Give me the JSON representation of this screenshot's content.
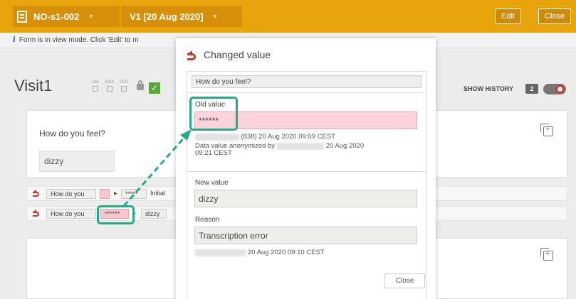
{
  "topbar": {
    "subject": "NO-s1-002",
    "visit": "V1 [20 Aug 2020]",
    "edit_label": "Edit",
    "close_label": "Close"
  },
  "info": {
    "text": "Form is in view mode. Click 'Edit' to m"
  },
  "visit": {
    "title": "Visit1",
    "flags": [
      "DM",
      "CRA",
      "SDV"
    ],
    "show_history_label": "SHOW HISTORY",
    "history_count": "2"
  },
  "form": {
    "question": "How do you feel?",
    "value": "dizzy"
  },
  "history_rows": [
    {
      "question": "How do you",
      "old": "",
      "new": "*****",
      "note": "Initial"
    },
    {
      "question": "How do you",
      "old": "******",
      "new": "dizzy",
      "note": ""
    }
  ],
  "dialog": {
    "title": "Changed value",
    "question": "How do you feel?",
    "old_label": "Old value",
    "old_value": "******",
    "old_meta": "(838) 20 Aug 2020 09:09 CEST",
    "anon_prefix": "Data value anonymized by",
    "anon_date_1": "20 Aug 2020",
    "anon_date_2": "09:21 CEST",
    "new_label": "New value",
    "new_value": "dizzy",
    "reason_label": "Reason",
    "reason_value": "Transcription error",
    "reason_meta": "20 Aug 2020 09:10 CEST",
    "close_label": "Close"
  },
  "colors": {
    "topbar": "#e8a40c",
    "highlight": "#26ab86",
    "changed": "#c0392b"
  }
}
